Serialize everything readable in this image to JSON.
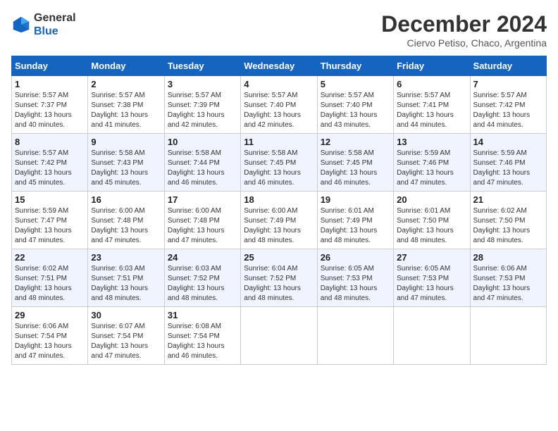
{
  "header": {
    "logo": {
      "line1": "General",
      "line2": "Blue"
    },
    "title": "December 2024",
    "location": "Ciervo Petiso, Chaco, Argentina"
  },
  "calendar": {
    "days_of_week": [
      "Sunday",
      "Monday",
      "Tuesday",
      "Wednesday",
      "Thursday",
      "Friday",
      "Saturday"
    ],
    "weeks": [
      [
        {
          "day": "1",
          "sunrise": "5:57 AM",
          "sunset": "7:37 PM",
          "daylight": "13 hours and 40 minutes."
        },
        {
          "day": "2",
          "sunrise": "5:57 AM",
          "sunset": "7:38 PM",
          "daylight": "13 hours and 41 minutes."
        },
        {
          "day": "3",
          "sunrise": "5:57 AM",
          "sunset": "7:39 PM",
          "daylight": "13 hours and 42 minutes."
        },
        {
          "day": "4",
          "sunrise": "5:57 AM",
          "sunset": "7:40 PM",
          "daylight": "13 hours and 42 minutes."
        },
        {
          "day": "5",
          "sunrise": "5:57 AM",
          "sunset": "7:40 PM",
          "daylight": "13 hours and 43 minutes."
        },
        {
          "day": "6",
          "sunrise": "5:57 AM",
          "sunset": "7:41 PM",
          "daylight": "13 hours and 44 minutes."
        },
        {
          "day": "7",
          "sunrise": "5:57 AM",
          "sunset": "7:42 PM",
          "daylight": "13 hours and 44 minutes."
        }
      ],
      [
        {
          "day": "8",
          "sunrise": "5:57 AM",
          "sunset": "7:42 PM",
          "daylight": "13 hours and 45 minutes."
        },
        {
          "day": "9",
          "sunrise": "5:58 AM",
          "sunset": "7:43 PM",
          "daylight": "13 hours and 45 minutes."
        },
        {
          "day": "10",
          "sunrise": "5:58 AM",
          "sunset": "7:44 PM",
          "daylight": "13 hours and 46 minutes."
        },
        {
          "day": "11",
          "sunrise": "5:58 AM",
          "sunset": "7:45 PM",
          "daylight": "13 hours and 46 minutes."
        },
        {
          "day": "12",
          "sunrise": "5:58 AM",
          "sunset": "7:45 PM",
          "daylight": "13 hours and 46 minutes."
        },
        {
          "day": "13",
          "sunrise": "5:59 AM",
          "sunset": "7:46 PM",
          "daylight": "13 hours and 47 minutes."
        },
        {
          "day": "14",
          "sunrise": "5:59 AM",
          "sunset": "7:46 PM",
          "daylight": "13 hours and 47 minutes."
        }
      ],
      [
        {
          "day": "15",
          "sunrise": "5:59 AM",
          "sunset": "7:47 PM",
          "daylight": "13 hours and 47 minutes."
        },
        {
          "day": "16",
          "sunrise": "6:00 AM",
          "sunset": "7:48 PM",
          "daylight": "13 hours and 47 minutes."
        },
        {
          "day": "17",
          "sunrise": "6:00 AM",
          "sunset": "7:48 PM",
          "daylight": "13 hours and 47 minutes."
        },
        {
          "day": "18",
          "sunrise": "6:00 AM",
          "sunset": "7:49 PM",
          "daylight": "13 hours and 48 minutes."
        },
        {
          "day": "19",
          "sunrise": "6:01 AM",
          "sunset": "7:49 PM",
          "daylight": "13 hours and 48 minutes."
        },
        {
          "day": "20",
          "sunrise": "6:01 AM",
          "sunset": "7:50 PM",
          "daylight": "13 hours and 48 minutes."
        },
        {
          "day": "21",
          "sunrise": "6:02 AM",
          "sunset": "7:50 PM",
          "daylight": "13 hours and 48 minutes."
        }
      ],
      [
        {
          "day": "22",
          "sunrise": "6:02 AM",
          "sunset": "7:51 PM",
          "daylight": "13 hours and 48 minutes."
        },
        {
          "day": "23",
          "sunrise": "6:03 AM",
          "sunset": "7:51 PM",
          "daylight": "13 hours and 48 minutes."
        },
        {
          "day": "24",
          "sunrise": "6:03 AM",
          "sunset": "7:52 PM",
          "daylight": "13 hours and 48 minutes."
        },
        {
          "day": "25",
          "sunrise": "6:04 AM",
          "sunset": "7:52 PM",
          "daylight": "13 hours and 48 minutes."
        },
        {
          "day": "26",
          "sunrise": "6:05 AM",
          "sunset": "7:53 PM",
          "daylight": "13 hours and 48 minutes."
        },
        {
          "day": "27",
          "sunrise": "6:05 AM",
          "sunset": "7:53 PM",
          "daylight": "13 hours and 47 minutes."
        },
        {
          "day": "28",
          "sunrise": "6:06 AM",
          "sunset": "7:53 PM",
          "daylight": "13 hours and 47 minutes."
        }
      ],
      [
        {
          "day": "29",
          "sunrise": "6:06 AM",
          "sunset": "7:54 PM",
          "daylight": "13 hours and 47 minutes."
        },
        {
          "day": "30",
          "sunrise": "6:07 AM",
          "sunset": "7:54 PM",
          "daylight": "13 hours and 47 minutes."
        },
        {
          "day": "31",
          "sunrise": "6:08 AM",
          "sunset": "7:54 PM",
          "daylight": "13 hours and 46 minutes."
        },
        null,
        null,
        null,
        null
      ]
    ]
  }
}
